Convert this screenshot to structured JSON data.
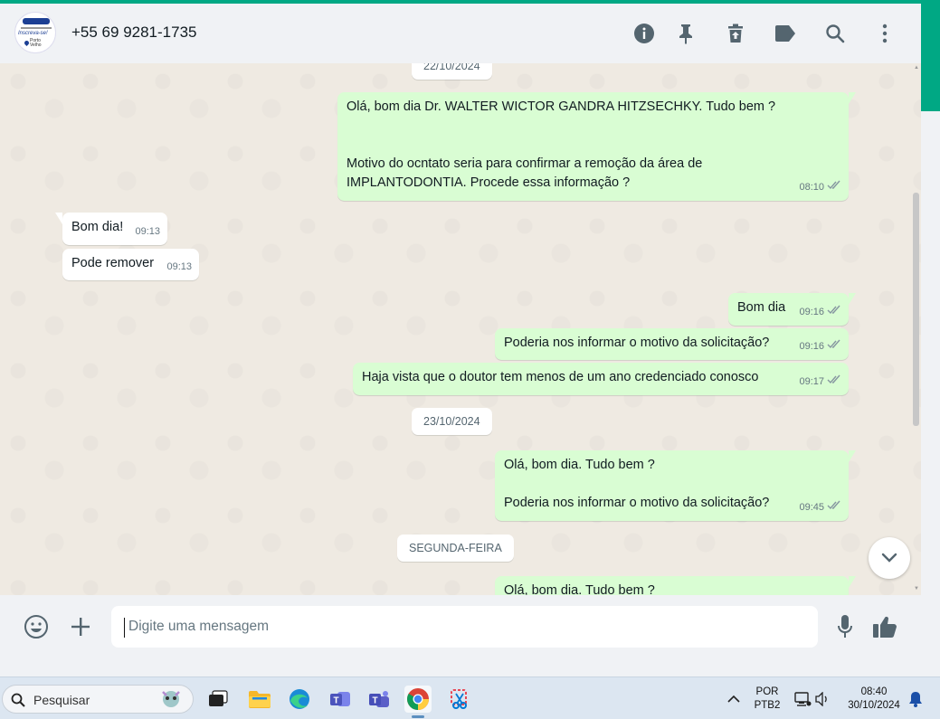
{
  "header": {
    "contact_name": "+55 69 9281-1735",
    "avatar_text": "Inscreva-se!",
    "avatar_location": "Porto Velho",
    "icons": [
      "info-icon",
      "pin-icon",
      "delete-icon",
      "label-icon",
      "search-icon",
      "menu-icon"
    ]
  },
  "chat": {
    "dates": {
      "d1": "22/10/2024",
      "d2": "23/10/2024",
      "d3": "SEGUNDA-FEIRA"
    },
    "messages": [
      {
        "dir": "out",
        "lines": [
          "Olá, bom dia Dr. WALTER WICTOR GANDRA HITZSECHKY. Tudo bem ?",
          "",
          "",
          "Motivo do ocntato seria para confirmar a remoção da área de",
          "IMPLANTODONTIA.  Procede essa informação ?"
        ],
        "time": "08:10"
      },
      {
        "dir": "in",
        "lines": [
          "Bom dia!"
        ],
        "time": "09:13"
      },
      {
        "dir": "in",
        "lines": [
          "Pode remover"
        ],
        "time": "09:13"
      },
      {
        "dir": "out",
        "lines": [
          "Bom dia"
        ],
        "time": "09:16"
      },
      {
        "dir": "out",
        "lines": [
          "Poderia nos informar o motivo da solicitação?"
        ],
        "time": "09:16"
      },
      {
        "dir": "out",
        "lines": [
          "Haja vista que o doutor tem menos de um ano credenciado conosco"
        ],
        "time": "09:17"
      },
      {
        "dir": "out",
        "lines": [
          "Olá, bom dia. Tudo bem ?",
          "",
          "Poderia nos informar o motivo da solicitação?"
        ],
        "time": "09:45"
      },
      {
        "dir": "out",
        "lines": [
          "Olá, bom dia. Tudo bem ?"
        ],
        "time": ""
      }
    ]
  },
  "composer": {
    "placeholder": "Digite uma mensagem",
    "icons": [
      "emoji-icon",
      "plus-icon",
      "microphone-icon",
      "thumbs-up-icon"
    ]
  },
  "taskbar": {
    "search_placeholder": "Pesquisar",
    "lang_top": "POR",
    "lang_bottom": "PTB2",
    "time": "08:40",
    "date": "30/10/2024"
  },
  "colors": {
    "accent": "#00a884",
    "outgoing": "#d9fdd3",
    "incoming": "#ffffff",
    "read_ticks": "#8696a0"
  }
}
